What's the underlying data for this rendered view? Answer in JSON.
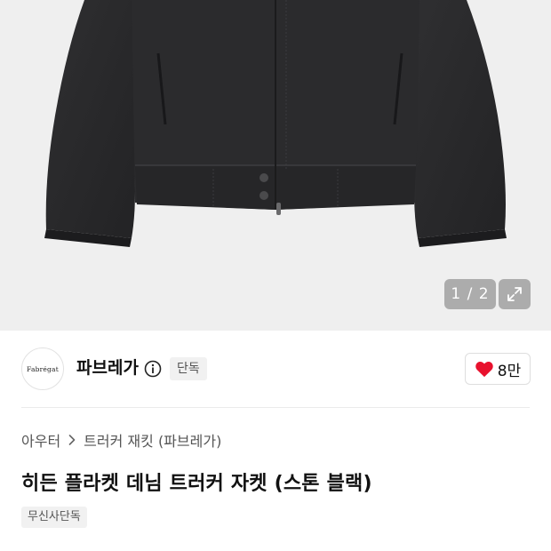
{
  "gallery": {
    "counter": "1 / 2",
    "expand_icon": "expand-icon"
  },
  "brand": {
    "logo_text": "Fabrégat",
    "name": "파브레가",
    "badge": "단독",
    "info_icon": "info-icon"
  },
  "like": {
    "count": "8만",
    "icon": "heart-icon",
    "color": "#e8112d"
  },
  "breadcrumb": {
    "category": "아우터",
    "subcategory": "트러커 재킷 (파브레가)"
  },
  "product": {
    "title": "히든 플라켓 데님 트러커 자켓 (스톤 블랙)",
    "tag": "무신사단독"
  }
}
